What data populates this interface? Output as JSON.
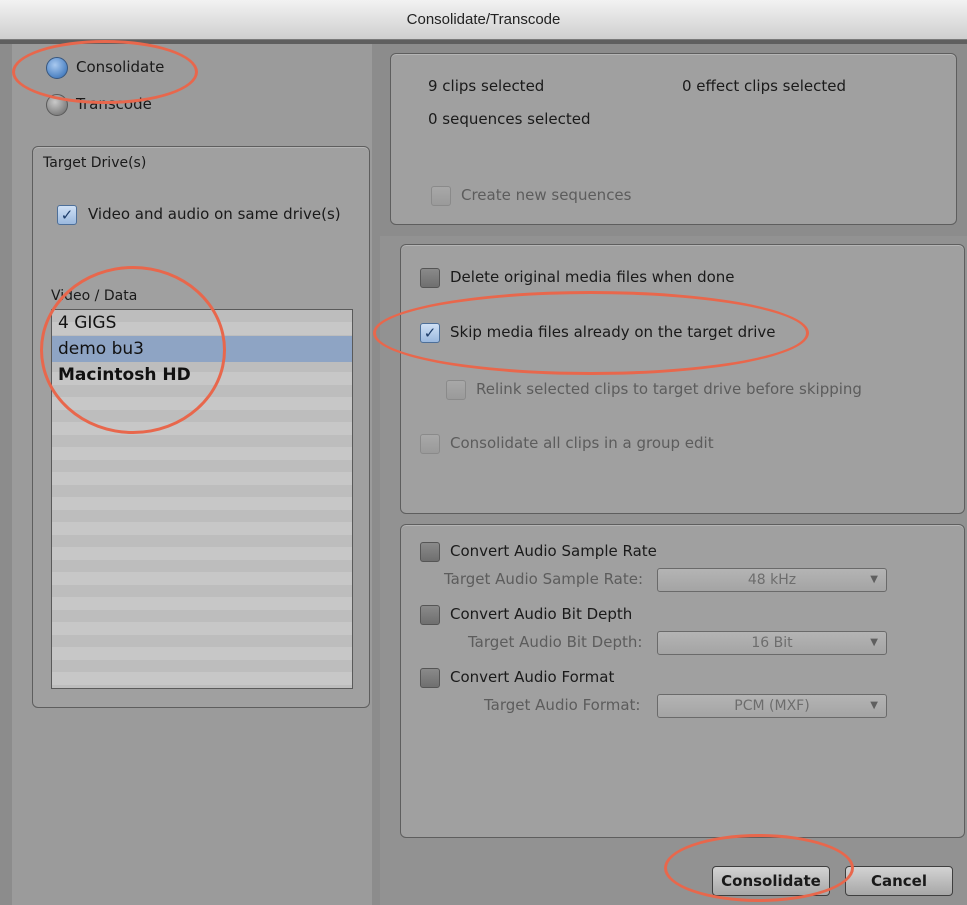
{
  "window": {
    "title": "Consolidate/Transcode"
  },
  "mode": {
    "options": [
      {
        "label": "Consolidate",
        "selected": true
      },
      {
        "label": "Transcode",
        "selected": false
      }
    ]
  },
  "target_drives": {
    "title": "Target Drive(s)",
    "same_drive_label": "Video and audio on same drive(s)",
    "same_drive_checked": true,
    "list_label": "Video / Data",
    "drives": [
      {
        "name": "4 GIGS",
        "selected": false
      },
      {
        "name": "demo bu3",
        "selected": true
      },
      {
        "name": "Macintosh HD",
        "selected": false
      }
    ]
  },
  "selection_info": {
    "clips": "9 clips selected",
    "effect_clips": "0 effect clips selected",
    "sequences": "0 sequences selected",
    "create_sequences_label": "Create new sequences"
  },
  "options": {
    "delete_original": "Delete original media files when done",
    "skip_media": "Skip media files already on the target drive",
    "relink": "Relink selected clips to target drive before skipping",
    "consolidate_group": "Consolidate all clips in a group edit",
    "skip_checked": true
  },
  "audio": {
    "sample_rate_check": "Convert Audio Sample Rate",
    "sample_rate_label": "Target Audio Sample Rate:",
    "sample_rate_value": "48 kHz",
    "bit_depth_check": "Convert Audio Bit Depth",
    "bit_depth_label": "Target Audio Bit Depth:",
    "bit_depth_value": "16 Bit",
    "format_check": "Convert Audio Format",
    "format_label": "Target Audio Format:",
    "format_value": "PCM (MXF)"
  },
  "buttons": {
    "ok": "Consolidate",
    "cancel": "Cancel"
  },
  "annotation_color": "#e8674c"
}
